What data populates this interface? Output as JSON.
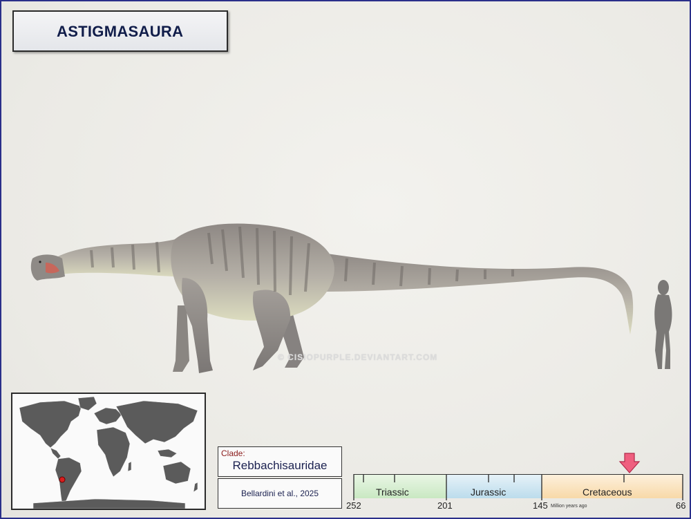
{
  "title": "ASTIGMASAURA",
  "watermark": "© CISIOPURPLE.DEVIANTART.COM",
  "clade": {
    "label": "Clade:",
    "name": "Rebbachisauridae"
  },
  "authority": "Bellardini et al., 2025",
  "timeline": {
    "periods": [
      "Triassic",
      "Jurassic",
      "Cretaceous"
    ],
    "ticks": [
      "252",
      "201",
      "145",
      "66"
    ],
    "unit": "Million years ago",
    "marker_mya": 93
  },
  "colors": {
    "triassic": "#c9e8c2",
    "jurassic": "#bcdcec",
    "cretaceous": "#f8d9a8",
    "marker": "#ef5f7f",
    "locality": "#d81e1e"
  },
  "icons": [
    "sauropod-illustration",
    "human-silhouette",
    "world-map",
    "locality-dot",
    "time-marker-arrow"
  ]
}
